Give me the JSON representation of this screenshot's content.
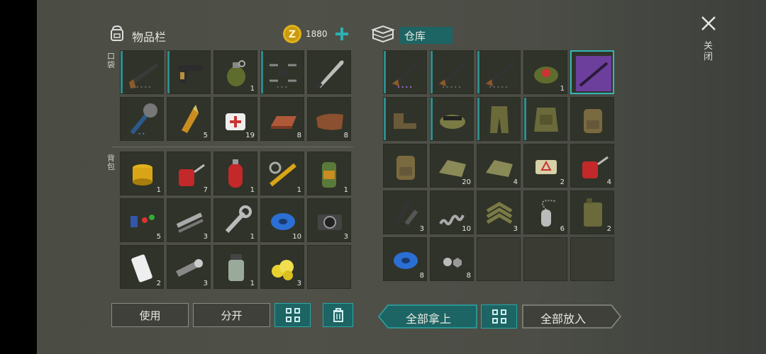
{
  "inventory": {
    "title": "物品栏",
    "currency": "1880",
    "pocket_label": "口袋",
    "backpack_label": "背包",
    "pocket": [
      {
        "icon": "shotgun",
        "dots": "•••••",
        "count": ""
      },
      {
        "icon": "pistol",
        "dots": "",
        "count": ""
      },
      {
        "icon": "grenade",
        "dots": "",
        "count": "1"
      },
      {
        "icon": "drone",
        "dots": "•••",
        "count": ""
      },
      {
        "icon": "machete",
        "dots": "",
        "count": ""
      },
      {
        "icon": "spiked-club",
        "dots": "••",
        "count": ""
      },
      {
        "icon": "bullet",
        "dots": "",
        "count": "5"
      },
      {
        "icon": "bandage",
        "dots": "",
        "count": "19"
      },
      {
        "icon": "copper-bar",
        "dots": "",
        "count": "8"
      },
      {
        "icon": "leather",
        "dots": "",
        "count": "8"
      }
    ],
    "backpack": [
      {
        "icon": "filter",
        "count": "1"
      },
      {
        "icon": "oil-can",
        "count": "7"
      },
      {
        "icon": "gas-tank",
        "count": "1"
      },
      {
        "icon": "spring-part",
        "count": "1"
      },
      {
        "icon": "battery",
        "count": "1"
      },
      {
        "icon": "electronic-parts",
        "count": "5"
      },
      {
        "icon": "pipes",
        "count": "3"
      },
      {
        "icon": "wrench",
        "count": "1"
      },
      {
        "icon": "tape",
        "count": "10"
      },
      {
        "icon": "camera",
        "count": "3"
      },
      {
        "icon": "phone",
        "count": "2"
      },
      {
        "icon": "flashlight",
        "count": "3"
      },
      {
        "icon": "chemical-jar",
        "count": "1"
      },
      {
        "icon": "gold-nuggets",
        "count": "3"
      },
      {
        "icon": "",
        "count": ""
      }
    ],
    "buttons": {
      "use": "使用",
      "split": "分开"
    }
  },
  "storage": {
    "title": "仓库",
    "items": [
      {
        "icon": "ak-rifle",
        "dots": "••••",
        "count": ""
      },
      {
        "icon": "ak-rifle",
        "dots": "•••••",
        "count": ""
      },
      {
        "icon": "ak-rifle",
        "dots": "•••••",
        "count": ""
      },
      {
        "icon": "landmine",
        "dots": "",
        "count": "1"
      },
      {
        "icon": "rifle-blueprint",
        "dots": "",
        "count": ""
      },
      {
        "icon": "boots",
        "dots": "",
        "count": ""
      },
      {
        "icon": "goggles-hat",
        "dots": "",
        "count": ""
      },
      {
        "icon": "camo-pants",
        "dots": "",
        "count": ""
      },
      {
        "icon": "body-armor",
        "dots": "",
        "count": ""
      },
      {
        "icon": "backpack",
        "dots": "",
        "count": ""
      },
      {
        "icon": "backpack",
        "dots": "",
        "count": ""
      },
      {
        "icon": "cloth",
        "dots": "",
        "count": "20"
      },
      {
        "icon": "cloth",
        "dots": "",
        "count": "4"
      },
      {
        "icon": "explosive",
        "dots": "",
        "count": "2"
      },
      {
        "icon": "oil-can",
        "dots": "",
        "count": "4"
      },
      {
        "icon": "gun-parts",
        "dots": "",
        "count": "3"
      },
      {
        "icon": "spring",
        "dots": "",
        "count": "10"
      },
      {
        "icon": "sergeant-patch",
        "dots": "",
        "count": "3"
      },
      {
        "icon": "dog-tag",
        "dots": "",
        "count": "6"
      },
      {
        "icon": "jerrycan",
        "dots": "",
        "count": "2"
      },
      {
        "icon": "tape",
        "dots": "",
        "count": "8"
      },
      {
        "icon": "bolts",
        "dots": "",
        "count": "8"
      },
      {
        "icon": "",
        "dots": "",
        "count": ""
      },
      {
        "icon": "",
        "dots": "",
        "count": ""
      },
      {
        "icon": "",
        "dots": "",
        "count": ""
      }
    ],
    "buttons": {
      "take_all": "全部拿上",
      "put_all": "全部放入"
    }
  },
  "close": {
    "label": "关闭"
  },
  "colors": {
    "accent": "#2aa7a7",
    "slot_bg": "#303329",
    "coin": "#e2b21c"
  }
}
